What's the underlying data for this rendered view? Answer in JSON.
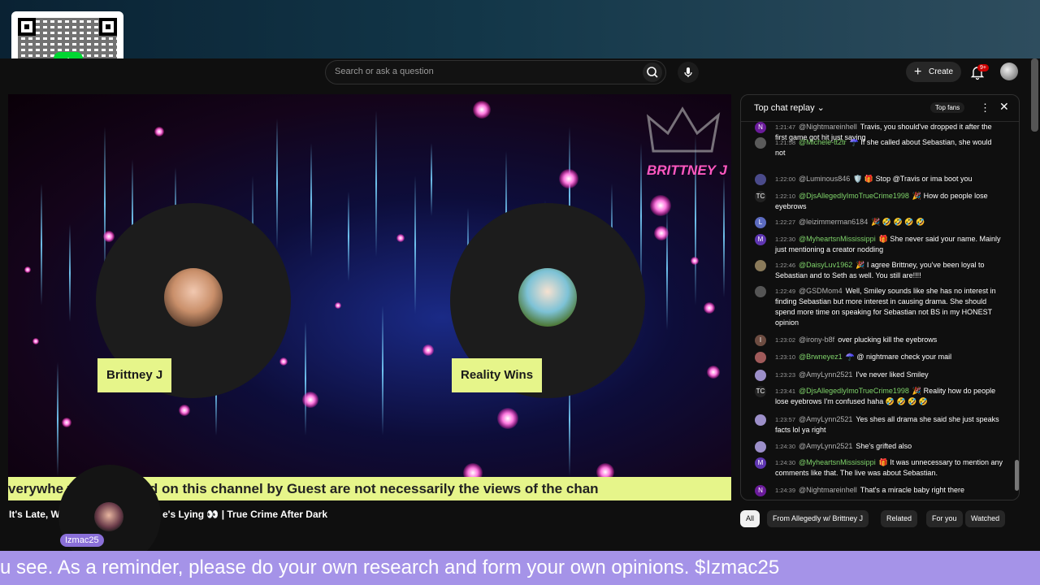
{
  "overlay": {
    "qr_icon": "cash-app-qr",
    "cashapp_symbol": "$",
    "bottom_ticker": "u see. As a reminder, please do your own research and form your own opinions. $Izmac25",
    "host_tag": "Izmac25"
  },
  "masthead": {
    "search_placeholder": "Search or ask a question",
    "create_label": "Create",
    "notif_badge": "9+"
  },
  "video": {
    "guest1": "Brittney J",
    "guest2": "Reality Wins",
    "brand_text": "BRITTNEY J",
    "ticker_text": "verywhe        ws expressed on this channel by Guest are not necessarily the views of the chan",
    "title_left": "It's Late, W",
    "title_right": "e's Lying 👀 | True Crime After Dark"
  },
  "chat": {
    "title": "Top chat replay",
    "top_fans": "Top fans",
    "messages": [
      {
        "initial": "N",
        "color": "#6a1b9a",
        "time": "1:21:47",
        "author": "@Nightmareinhell",
        "green": false,
        "text": "Travis, you should've dropped it after the first game got hit just saying"
      },
      {
        "initial": "",
        "color": "#5a5a5a",
        "time": "1:21:58",
        "author": "@Michele-tt2tr",
        "green": true,
        "text": "☂️  If she called about Sebastian, she would not"
      },
      {
        "initial": "",
        "color": "#4a4a8a",
        "time": "1:22:00",
        "author": "@Luminous846",
        "green": false,
        "text": "🛡️ 🎁  Stop @Travis or ima boot you"
      },
      {
        "initial": "TC",
        "color": "#222",
        "time": "1:22:10",
        "author": "@DjsAllegedlyImoTrueCrime1998",
        "green": true,
        "text": "🎉  How do people lose eyebrows"
      },
      {
        "initial": "L",
        "color": "#5c6bc0",
        "time": "1:22:27",
        "author": "@leizimmerman6184",
        "green": false,
        "text": "🎉  🤣 🤣 🤣 🤣"
      },
      {
        "initial": "M",
        "color": "#5e35b1",
        "time": "1:22:30",
        "author": "@MyheartsnMississippi",
        "green": true,
        "text": "🎁  She never said your name. Mainly just mentioning a creator nodding"
      },
      {
        "initial": "",
        "color": "#8a7a5a",
        "time": "1:22:46",
        "author": "@DaisyLuv1962",
        "green": true,
        "text": "🎉  I agree Brittney, you've been loyal to Sebastian and to Seth as well. You still are!!!!"
      },
      {
        "initial": "",
        "color": "#555",
        "time": "1:22:49",
        "author": "@GSDMom4",
        "green": false,
        "text": "Well, Smiley sounds like she has no interest in finding Sebastian but more interest in causing drama. She should spend more time on speaking for Sebastian not BS in my HONEST opinion"
      },
      {
        "initial": "I",
        "color": "#6d4c41",
        "time": "1:23:02",
        "author": "@irony-b8f",
        "green": false,
        "text": "over plucking kill the eyebrows"
      },
      {
        "initial": "",
        "color": "#a05a5a",
        "time": "1:23:10",
        "author": "@Brwneyez1",
        "green": true,
        "text": "☂️  @ nightmare check your mail"
      },
      {
        "initial": "",
        "color": "#9c8fc9",
        "time": "1:23:23",
        "author": "@AmyLynn2521",
        "green": false,
        "text": "I've never liked Smiley"
      },
      {
        "initial": "TC",
        "color": "#222",
        "time": "1:23:41",
        "author": "@DjsAllegedlyImoTrueCrime1998",
        "green": true,
        "text": "🎉  Reality how do people lose eyebrows I'm confused haha 🤣 🤣 🤣 🤣"
      },
      {
        "initial": "",
        "color": "#9c8fc9",
        "time": "1:23:57",
        "author": "@AmyLynn2521",
        "green": false,
        "text": "Yes shes all drama she said she just speaks facts lol ya right"
      },
      {
        "initial": "",
        "color": "#9c8fc9",
        "time": "1:24:30",
        "author": "@AmyLynn2521",
        "green": false,
        "text": "She's grifted also"
      },
      {
        "initial": "M",
        "color": "#5e35b1",
        "time": "1:24:30",
        "author": "@MyheartsnMississippi",
        "green": true,
        "text": "🎁  It was unnecessary to mention any comments like that. The live was about Sebastian."
      },
      {
        "initial": "N",
        "color": "#6a1b9a",
        "time": "1:24:39",
        "author": "@Nightmareinhell",
        "green": false,
        "text": "That's a miracle baby right there"
      }
    ]
  },
  "chips": [
    "All",
    "From Allegedly w/ Brittney J",
    "Related",
    "For you",
    "Watched"
  ]
}
